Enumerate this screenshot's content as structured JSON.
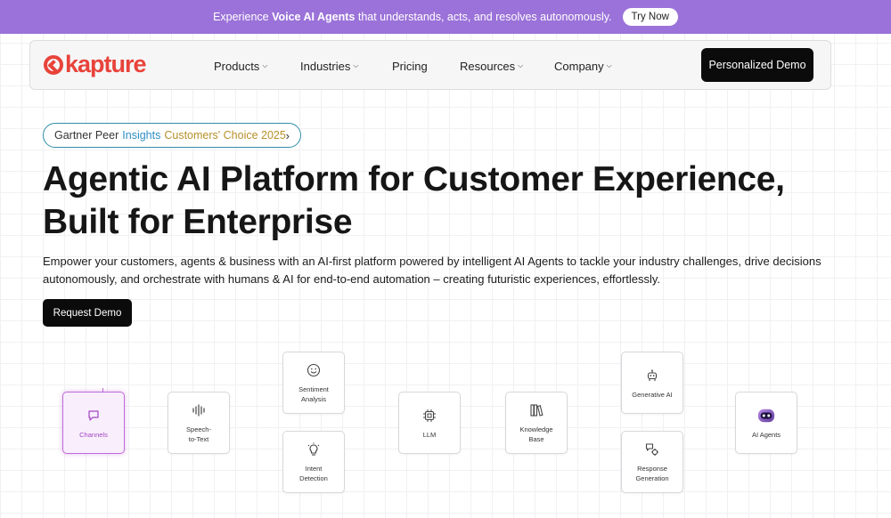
{
  "banner": {
    "prefix": "Experience ",
    "highlight": "Voice AI Agents",
    "suffix": " that understands, acts, and resolves autonomously.",
    "cta": "Try Now",
    "bg_color": "#9b72d9"
  },
  "nav": {
    "logo_text": "kapture",
    "brand_color": "#e8433a",
    "items": [
      {
        "label": "Products",
        "has_dropdown": true
      },
      {
        "label": "Industries",
        "has_dropdown": true
      },
      {
        "label": "Pricing",
        "has_dropdown": false
      },
      {
        "label": "Resources",
        "has_dropdown": true
      },
      {
        "label": "Company",
        "has_dropdown": true
      }
    ],
    "chevron_icon": "chevron-down-icon",
    "cta": "Personalized Demo"
  },
  "badge": {
    "part1": "Gartner Peer",
    "part2": "Insights",
    "part3": "Customers' Choice 2025",
    "chevron": "›"
  },
  "hero": {
    "title_line1": "Agentic AI Platform for Customer Experience,",
    "title_line2": "Built for Enterprise",
    "subtitle": "Empower your customers, agents & business with an AI-first platform powered by intelligent AI Agents to tackle your industry challenges, drive decisions autonomously, and orchestrate with humans & AI for end-to-end automation – creating futuristic experiences, effortlessly.",
    "cta": "Request Demo"
  },
  "flow": {
    "accent_color": "#c06ad8",
    "nodes": [
      {
        "label": "Channels",
        "icon": "chat-bubble-icon",
        "active": true
      },
      {
        "label": "Speech-\nto-Text",
        "icon": "waveform-icon",
        "active": false
      },
      {
        "label": "Sentiment\nAnalysis",
        "icon": "smiley-icon",
        "active": false
      },
      {
        "label": "Intent\nDetection",
        "icon": "lightbulb-icon",
        "active": false
      },
      {
        "label": "LLM",
        "icon": "chip-icon",
        "active": false
      },
      {
        "label": "Knowledge\nBase",
        "icon": "books-icon",
        "active": false
      },
      {
        "label": "Generative AI",
        "icon": "robot-icon",
        "active": false
      },
      {
        "label": "Response\nGeneration",
        "icon": "chat-gear-icon",
        "active": false
      },
      {
        "label": "AI Agents",
        "icon": "ai-agent-icon",
        "active": false
      }
    ]
  }
}
